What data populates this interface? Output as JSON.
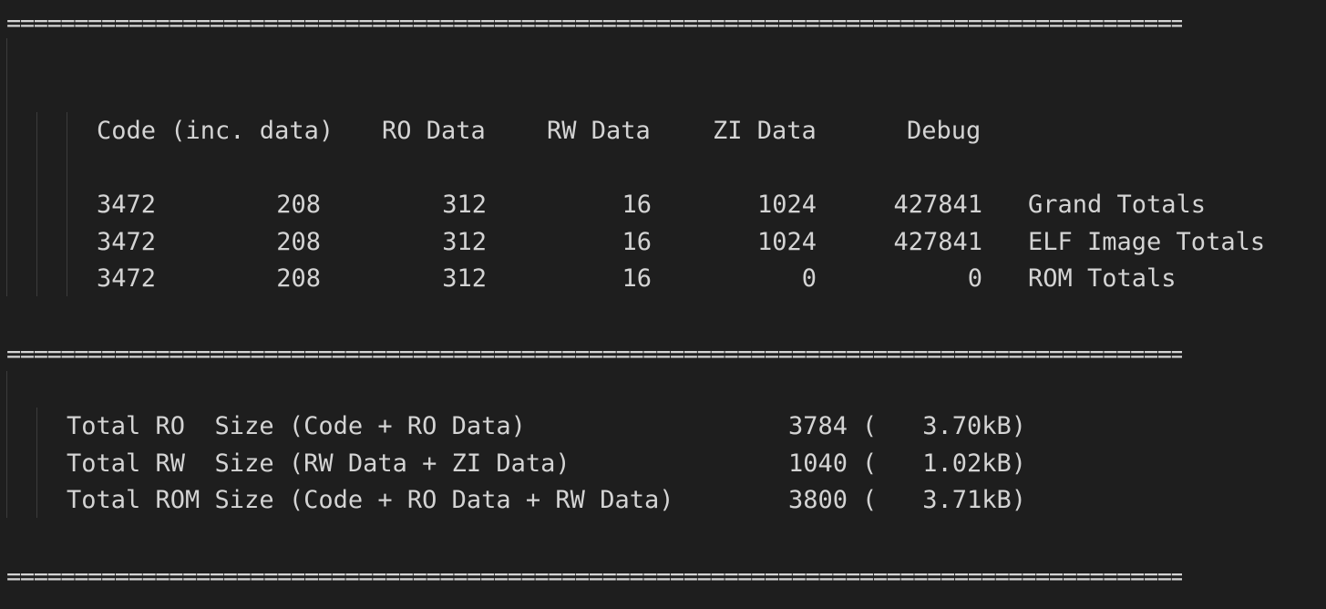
{
  "separator": "==============================================================================================================",
  "summary_table": {
    "headers": {
      "code": "Code (inc. data)",
      "ro_data": "RO Data",
      "rw_data": "RW Data",
      "zi_data": "ZI Data",
      "debug": "Debug"
    },
    "rows": [
      {
        "code": "3472",
        "inc_data": "208",
        "ro_data": "312",
        "rw_data": "16",
        "zi_data": "1024",
        "debug": "427841",
        "label": "Grand Totals"
      },
      {
        "code": "3472",
        "inc_data": "208",
        "ro_data": "312",
        "rw_data": "16",
        "zi_data": "1024",
        "debug": "427841",
        "label": "ELF Image Totals"
      },
      {
        "code": "3472",
        "inc_data": "208",
        "ro_data": "312",
        "rw_data": "16",
        "zi_data": "0",
        "debug": "0",
        "label": "ROM Totals"
      }
    ]
  },
  "size_totals": [
    {
      "label": "Total RO  Size (Code + RO Data)",
      "value": "3784",
      "paren_open": "(",
      "kb": "3.70kB)"
    },
    {
      "label": "Total RW  Size (RW Data + ZI Data)",
      "value": "1040",
      "paren_open": "(",
      "kb": "1.02kB)"
    },
    {
      "label": "Total ROM Size (Code + RO Data + RW Data)",
      "value": "3800",
      "paren_open": "(",
      "kb": "3.71kB)"
    }
  ],
  "colors": {
    "background": "#1e1e1e",
    "text": "#d4d4d4",
    "indent_guide": "#3c3c3c"
  }
}
